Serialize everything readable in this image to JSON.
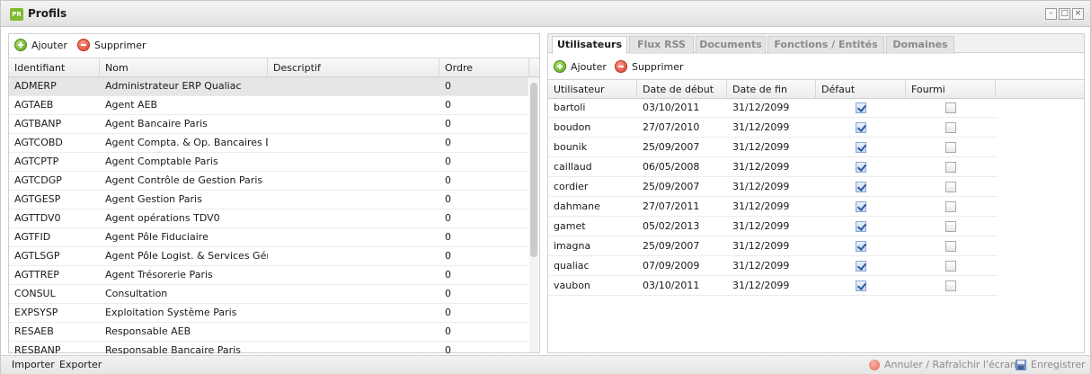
{
  "window": {
    "title": "Profils",
    "app_icon_text": "PR",
    "controls": [
      "–",
      "□",
      "×"
    ]
  },
  "left": {
    "toolbar": {
      "add_label": "Ajouter",
      "delete_label": "Supprimer"
    },
    "columns": [
      "Identifiant",
      "Nom",
      "Descriptif",
      "Ordre"
    ],
    "rows": [
      {
        "id": "ADMERP",
        "nom": "Administrateur ERP Qualiac",
        "desc": "",
        "ordre": "0"
      },
      {
        "id": "AGTAEB",
        "nom": "Agent AEB",
        "desc": "",
        "ordre": "0"
      },
      {
        "id": "AGTBANP",
        "nom": "Agent Bancaire Paris",
        "desc": "",
        "ordre": "0"
      },
      {
        "id": "AGTCOBD",
        "nom": "Agent Compta. & Op. Bancaires D...",
        "desc": "",
        "ordre": "0"
      },
      {
        "id": "AGTCPTP",
        "nom": "Agent Comptable Paris",
        "desc": "",
        "ordre": "0"
      },
      {
        "id": "AGTCDGP",
        "nom": "Agent Contrôle de Gestion Paris",
        "desc": "",
        "ordre": "0"
      },
      {
        "id": "AGTGESP",
        "nom": "Agent Gestion Paris",
        "desc": "",
        "ordre": "0"
      },
      {
        "id": "AGTTDV0",
        "nom": "Agent opérations TDV0",
        "desc": "",
        "ordre": "0"
      },
      {
        "id": "AGTFID",
        "nom": "Agent Pôle Fiduciaire",
        "desc": "",
        "ordre": "0"
      },
      {
        "id": "AGTLSGP",
        "nom": "Agent Pôle Logist. & Services Gén....",
        "desc": "",
        "ordre": "0"
      },
      {
        "id": "AGTTREP",
        "nom": "Agent Trésorerie Paris",
        "desc": "",
        "ordre": "0"
      },
      {
        "id": "CONSUL",
        "nom": "Consultation",
        "desc": "",
        "ordre": "0"
      },
      {
        "id": "EXPSYSP",
        "nom": "Exploitation Système Paris",
        "desc": "",
        "ordre": "0"
      },
      {
        "id": "RESAEB",
        "nom": "Responsable AEB",
        "desc": "",
        "ordre": "0"
      },
      {
        "id": "RESBANP",
        "nom": "Responsable Bancaire Paris",
        "desc": "",
        "ordre": "0"
      }
    ]
  },
  "right": {
    "tabs": [
      "Utilisateurs",
      "Flux RSS",
      "Documents",
      "Fonctions / Entités",
      "Domaines"
    ],
    "active_tab": "Utilisateurs",
    "toolbar": {
      "add_label": "Ajouter",
      "delete_label": "Supprimer"
    },
    "columns": [
      "Utilisateur",
      "Date de début",
      "Date de fin",
      "Défaut",
      "Fourmi"
    ],
    "rows": [
      {
        "user": "bartoli",
        "debut": "03/10/2011",
        "fin": "31/12/2099",
        "defaut": true,
        "fourmi": false
      },
      {
        "user": "boudon",
        "debut": "27/07/2010",
        "fin": "31/12/2099",
        "defaut": true,
        "fourmi": false
      },
      {
        "user": "bounik",
        "debut": "25/09/2007",
        "fin": "31/12/2099",
        "defaut": true,
        "fourmi": false
      },
      {
        "user": "caillaud",
        "debut": "06/05/2008",
        "fin": "31/12/2099",
        "defaut": true,
        "fourmi": false
      },
      {
        "user": "cordier",
        "debut": "25/09/2007",
        "fin": "31/12/2099",
        "defaut": true,
        "fourmi": false
      },
      {
        "user": "dahmane",
        "debut": "27/07/2011",
        "fin": "31/12/2099",
        "defaut": true,
        "fourmi": false
      },
      {
        "user": "gamet",
        "debut": "05/02/2013",
        "fin": "31/12/2099",
        "defaut": true,
        "fourmi": false
      },
      {
        "user": "imagna",
        "debut": "25/09/2007",
        "fin": "31/12/2099",
        "defaut": true,
        "fourmi": false
      },
      {
        "user": "qualiac",
        "debut": "07/09/2009",
        "fin": "31/12/2099",
        "defaut": true,
        "fourmi": false
      },
      {
        "user": "vaubon",
        "debut": "03/10/2011",
        "fin": "31/12/2099",
        "defaut": true,
        "fourmi": false
      }
    ]
  },
  "bottom": {
    "import_label": "Importer",
    "export_label": "Exporter",
    "cancel_label": "Annuler / Rafraîchir l'écran",
    "save_label": "Enregistrer"
  }
}
